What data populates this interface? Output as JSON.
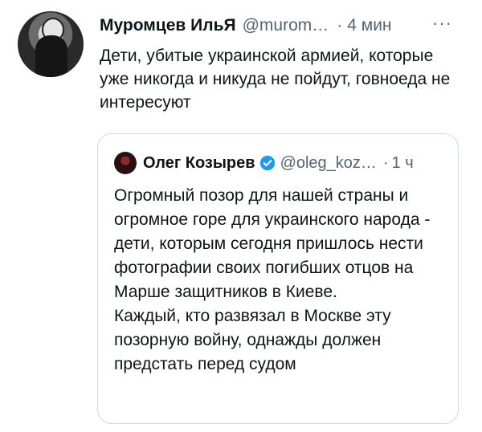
{
  "tweet": {
    "author_name": "Муромцев ИльЯ",
    "author_handle": "@murom…",
    "separator": "·",
    "time": "4 мин",
    "more": "···",
    "text": "Дети, убитые украинской армией, которые уже никогда и никуда не пойдут, говноеда не интересуют"
  },
  "quoted_tweet": {
    "author_name": "Олег Козырев",
    "author_handle": "@oleg_koz…",
    "separator": "·",
    "time": "1 ч",
    "verified_icon": "verified-badge-icon",
    "text_p1": "Огромный позор для нашей страны и огромное горе для украинского народа - дети, которым сегодня пришлось нести фотографии своих погибших отцов на Марше защитников в Киеве.",
    "text_p2": "Каждый, кто развязал в Москве эту позорную войну, однажды должен предстать перед судом"
  },
  "colors": {
    "text": "#0f1419",
    "secondary": "#536471",
    "verified": "#1d9bf0",
    "border": "#cfd9de"
  }
}
